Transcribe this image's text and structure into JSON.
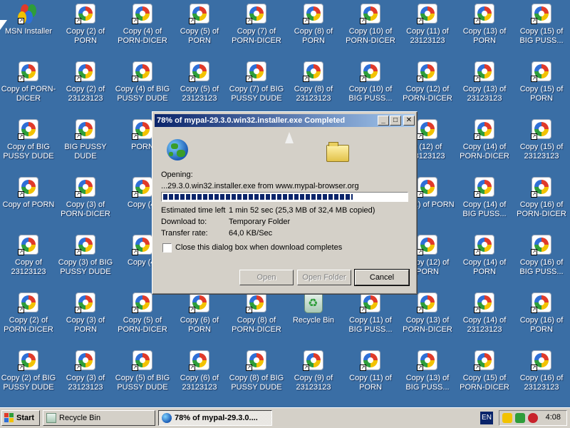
{
  "desktop": {
    "icons": [
      {
        "label": "MSN Installer",
        "icon": "msn-icon"
      },
      {
        "label": "Copy (2) of PORN",
        "icon": "media-file-icon"
      },
      {
        "label": "Copy (4) of PORN-DICER",
        "icon": "media-file-icon"
      },
      {
        "label": "Copy (5) of PORN",
        "icon": "media-file-icon"
      },
      {
        "label": "Copy (7) of PORN-DICER",
        "icon": "media-file-icon"
      },
      {
        "label": "Copy (8) of PORN",
        "icon": "media-file-icon"
      },
      {
        "label": "Copy (10) of PORN-DICER",
        "icon": "media-file-icon"
      },
      {
        "label": "Copy (11) of 23123123",
        "icon": "media-file-icon"
      },
      {
        "label": "Copy (13) of PORN",
        "icon": "media-file-icon"
      },
      {
        "label": "Copy (15) of BIG PUSS...",
        "icon": "media-file-icon"
      },
      {
        "label": "Copy of PORN-DICER",
        "icon": "media-file-icon"
      },
      {
        "label": "Copy (2) of 23123123",
        "icon": "media-file-icon"
      },
      {
        "label": "Copy (4) of BIG PUSSY DUDE",
        "icon": "media-file-icon"
      },
      {
        "label": "Copy (5) of 23123123",
        "icon": "media-file-icon"
      },
      {
        "label": "Copy (7) of BIG PUSSY DUDE",
        "icon": "media-file-icon"
      },
      {
        "label": "Copy (8) of 23123123",
        "icon": "media-file-icon"
      },
      {
        "label": "Copy (10) of BIG PUSS...",
        "icon": "media-file-icon"
      },
      {
        "label": "Copy (12) of PORN-DICER",
        "icon": "media-file-icon"
      },
      {
        "label": "Copy (13) of 23123123",
        "icon": "media-file-icon"
      },
      {
        "label": "Copy (15) of PORN",
        "icon": "media-file-icon"
      },
      {
        "label": "Copy of BIG PUSSY DUDE",
        "icon": "media-file-icon"
      },
      {
        "label": "BIG PUSSY DUDE",
        "icon": "media-file-icon"
      },
      {
        "label": "PORN",
        "icon": "media-file-icon"
      },
      {
        "label": "",
        "icon": "media-file-icon"
      },
      {
        "label": "",
        "icon": "media-file-icon"
      },
      {
        "label": "",
        "icon": "media-file-icon"
      },
      {
        "label": "",
        "icon": "media-file-icon"
      },
      {
        "label": "y (12) of 23123123",
        "icon": "media-file-icon"
      },
      {
        "label": "Copy (14) of PORN-DICER",
        "icon": "media-file-icon"
      },
      {
        "label": "Copy (15) of 23123123",
        "icon": "media-file-icon"
      },
      {
        "label": "Copy of PORN",
        "icon": "media-file-icon"
      },
      {
        "label": "Copy (3) of PORN-DICER",
        "icon": "media-file-icon"
      },
      {
        "label": "Copy (4)",
        "icon": "media-file-icon"
      },
      {
        "label": "",
        "icon": "media-file-icon"
      },
      {
        "label": "",
        "icon": "media-file-icon"
      },
      {
        "label": "",
        "icon": "media-file-icon"
      },
      {
        "label": "",
        "icon": "media-file-icon"
      },
      {
        "label": "y (12) of PORN",
        "icon": "media-file-icon"
      },
      {
        "label": "Copy (14) of BIG PUSS...",
        "icon": "media-file-icon"
      },
      {
        "label": "Copy (16) of PORN-DICER",
        "icon": "media-file-icon"
      },
      {
        "label": "Copy of 23123123",
        "icon": "media-file-icon"
      },
      {
        "label": "Copy (3) of BIG PUSSY DUDE",
        "icon": "media-file-icon"
      },
      {
        "label": "Copy (4)",
        "icon": "media-file-icon"
      },
      {
        "label": "",
        "icon": "media-file-icon"
      },
      {
        "label": "",
        "icon": "media-file-icon"
      },
      {
        "label": "",
        "icon": "media-file-icon"
      },
      {
        "label": "",
        "icon": "media-file-icon"
      },
      {
        "label": "Copy (12) of PORN",
        "icon": "media-file-icon"
      },
      {
        "label": "Copy (14) of PORN",
        "icon": "media-file-icon"
      },
      {
        "label": "Copy (16) of BIG PUSS...",
        "icon": "media-file-icon"
      },
      {
        "label": "Copy (2) of PORN-DICER",
        "icon": "media-file-icon"
      },
      {
        "label": "Copy (3) of PORN",
        "icon": "media-file-icon"
      },
      {
        "label": "Copy (5) of PORN-DICER",
        "icon": "media-file-icon"
      },
      {
        "label": "Copy (6) of PORN",
        "icon": "media-file-icon"
      },
      {
        "label": "Copy (8) of PORN-DICER",
        "icon": "media-file-icon"
      },
      {
        "label": "Recycle Bin",
        "icon": "recycle-bin-icon"
      },
      {
        "label": "Copy (11) of BIG PUSS...",
        "icon": "media-file-icon"
      },
      {
        "label": "Copy (13) of PORN-DICER",
        "icon": "media-file-icon"
      },
      {
        "label": "Copy (14) of 23123123",
        "icon": "media-file-icon"
      },
      {
        "label": "Copy (16) of PORN",
        "icon": "media-file-icon"
      },
      {
        "label": "Copy (2) of BIG PUSSY DUDE",
        "icon": "media-file-icon"
      },
      {
        "label": "Copy (3) of 23123123",
        "icon": "media-file-icon"
      },
      {
        "label": "Copy (5) of BIG PUSSY DUDE",
        "icon": "media-file-icon"
      },
      {
        "label": "Copy (6) of 23123123",
        "icon": "media-file-icon"
      },
      {
        "label": "Copy (8) of BIG PUSSY DUDE",
        "icon": "media-file-icon"
      },
      {
        "label": "Copy (9) of 23123123",
        "icon": "media-file-icon"
      },
      {
        "label": "Copy (11) of PORN",
        "icon": "media-file-icon"
      },
      {
        "label": "Copy (13) of BIG PUSS...",
        "icon": "media-file-icon"
      },
      {
        "label": "Copy (15) of PORN-DICER",
        "icon": "media-file-icon"
      },
      {
        "label": "Copy (16) of 23123123",
        "icon": "media-file-icon"
      }
    ]
  },
  "dialog": {
    "title": "78% of mypal-29.3.0.win32.installer.exe Completed",
    "minimize_glyph": "_",
    "maximize_glyph": "□",
    "close_glyph": "✕",
    "opening_label": "Opening:",
    "opening_value": "...29.3.0.win32.installer.exe from www.mypal-browser.org",
    "progress": 0.78,
    "estimated_label": "Estimated time left",
    "estimated_value": "1 min 52 sec (25,3 MB of 32,4 MB copied)",
    "download_to_label": "Download to:",
    "download_to_value": "Temporary Folder",
    "transfer_rate_label": "Transfer rate:",
    "transfer_rate_value": "64,0 KB/Sec",
    "close_checkbox_label": "Close this dialog box when download completes",
    "close_checkbox_checked": false,
    "open_button": "Open",
    "open_folder_button": "Open Folder",
    "cancel_button": "Cancel"
  },
  "taskbar": {
    "start_label": "Start",
    "tasks": [
      {
        "label": "Recycle Bin",
        "active": false
      },
      {
        "label": "78% of mypal-29.3.0....",
        "active": true
      }
    ],
    "language": "EN",
    "clock": "4:08"
  },
  "colors": {
    "desktop_bg": "#3a6ea5",
    "title_active_start": "#0a246a",
    "title_active_end": "#a6caf0",
    "progress_fill": "#0a246a"
  }
}
